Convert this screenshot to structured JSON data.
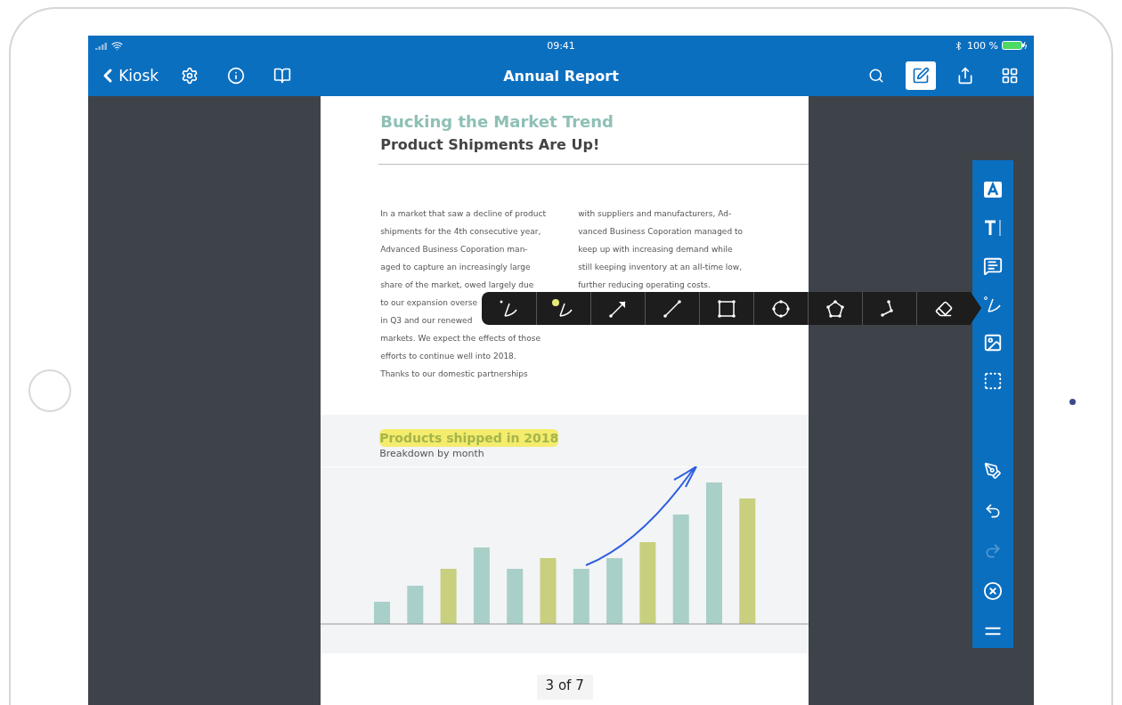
{
  "status_bar": {
    "time": "09:41",
    "battery": "100 %"
  },
  "nav_bar": {
    "back_label": "Kiosk",
    "title": "Annual Report",
    "left_actions": [
      {
        "kind": "settings"
      },
      {
        "kind": "info"
      },
      {
        "kind": "book"
      }
    ],
    "right_actions": [
      {
        "kind": "search",
        "selected": false
      },
      {
        "kind": "annotate",
        "selected": true
      },
      {
        "kind": "share",
        "selected": false
      },
      {
        "kind": "grid",
        "selected": false
      }
    ]
  },
  "document": {
    "heading": "Bucking the Market Trend",
    "subheading": "Product Shipments Are Up!",
    "columns": [
      [
        "In a market that saw a decline of product",
        "shipments for the 4th consecutive year,",
        "Advanced Business Coporation man-",
        "aged to capture an increasingly large",
        "share of the market, owed largely due",
        "to our expansion overse",
        "in Q3 and our renewed",
        "markets. We expect the effects of those",
        "efforts to continue well into 2018.",
        "Thanks to our domestic partnerships"
      ],
      [
        "with suppliers and manufacturers, Ad-",
        "vanced Business Coporation managed to",
        "keep up with increasing demand while",
        "still keeping inventory at an all-time low,",
        "further reducing operating costs."
      ]
    ],
    "chart_title": "Products shipped in 2018",
    "chart_subtitle": "Breakdown by month",
    "page_indicator": "3 of 7"
  },
  "annotation_toolbar": [
    {
      "kind": "freehand"
    },
    {
      "kind": "highlighter"
    },
    {
      "kind": "arrow"
    },
    {
      "kind": "line"
    },
    {
      "kind": "rectangle"
    },
    {
      "kind": "ellipse"
    },
    {
      "kind": "polygon"
    },
    {
      "kind": "polyline"
    },
    {
      "kind": "eraser"
    }
  ],
  "side_toolbar": [
    {
      "kind": "text-box",
      "disabled": false
    },
    {
      "kind": "text",
      "disabled": false
    },
    {
      "kind": "comment",
      "disabled": false
    },
    {
      "kind": "ink",
      "disabled": false
    },
    {
      "kind": "image",
      "disabled": false
    },
    {
      "kind": "selection",
      "disabled": false
    },
    {
      "kind": "pen",
      "disabled": false
    },
    {
      "kind": "undo",
      "disabled": false
    },
    {
      "kind": "redo",
      "disabled": true
    },
    {
      "kind": "close",
      "disabled": false
    },
    {
      "kind": "handle",
      "disabled": false
    }
  ]
}
